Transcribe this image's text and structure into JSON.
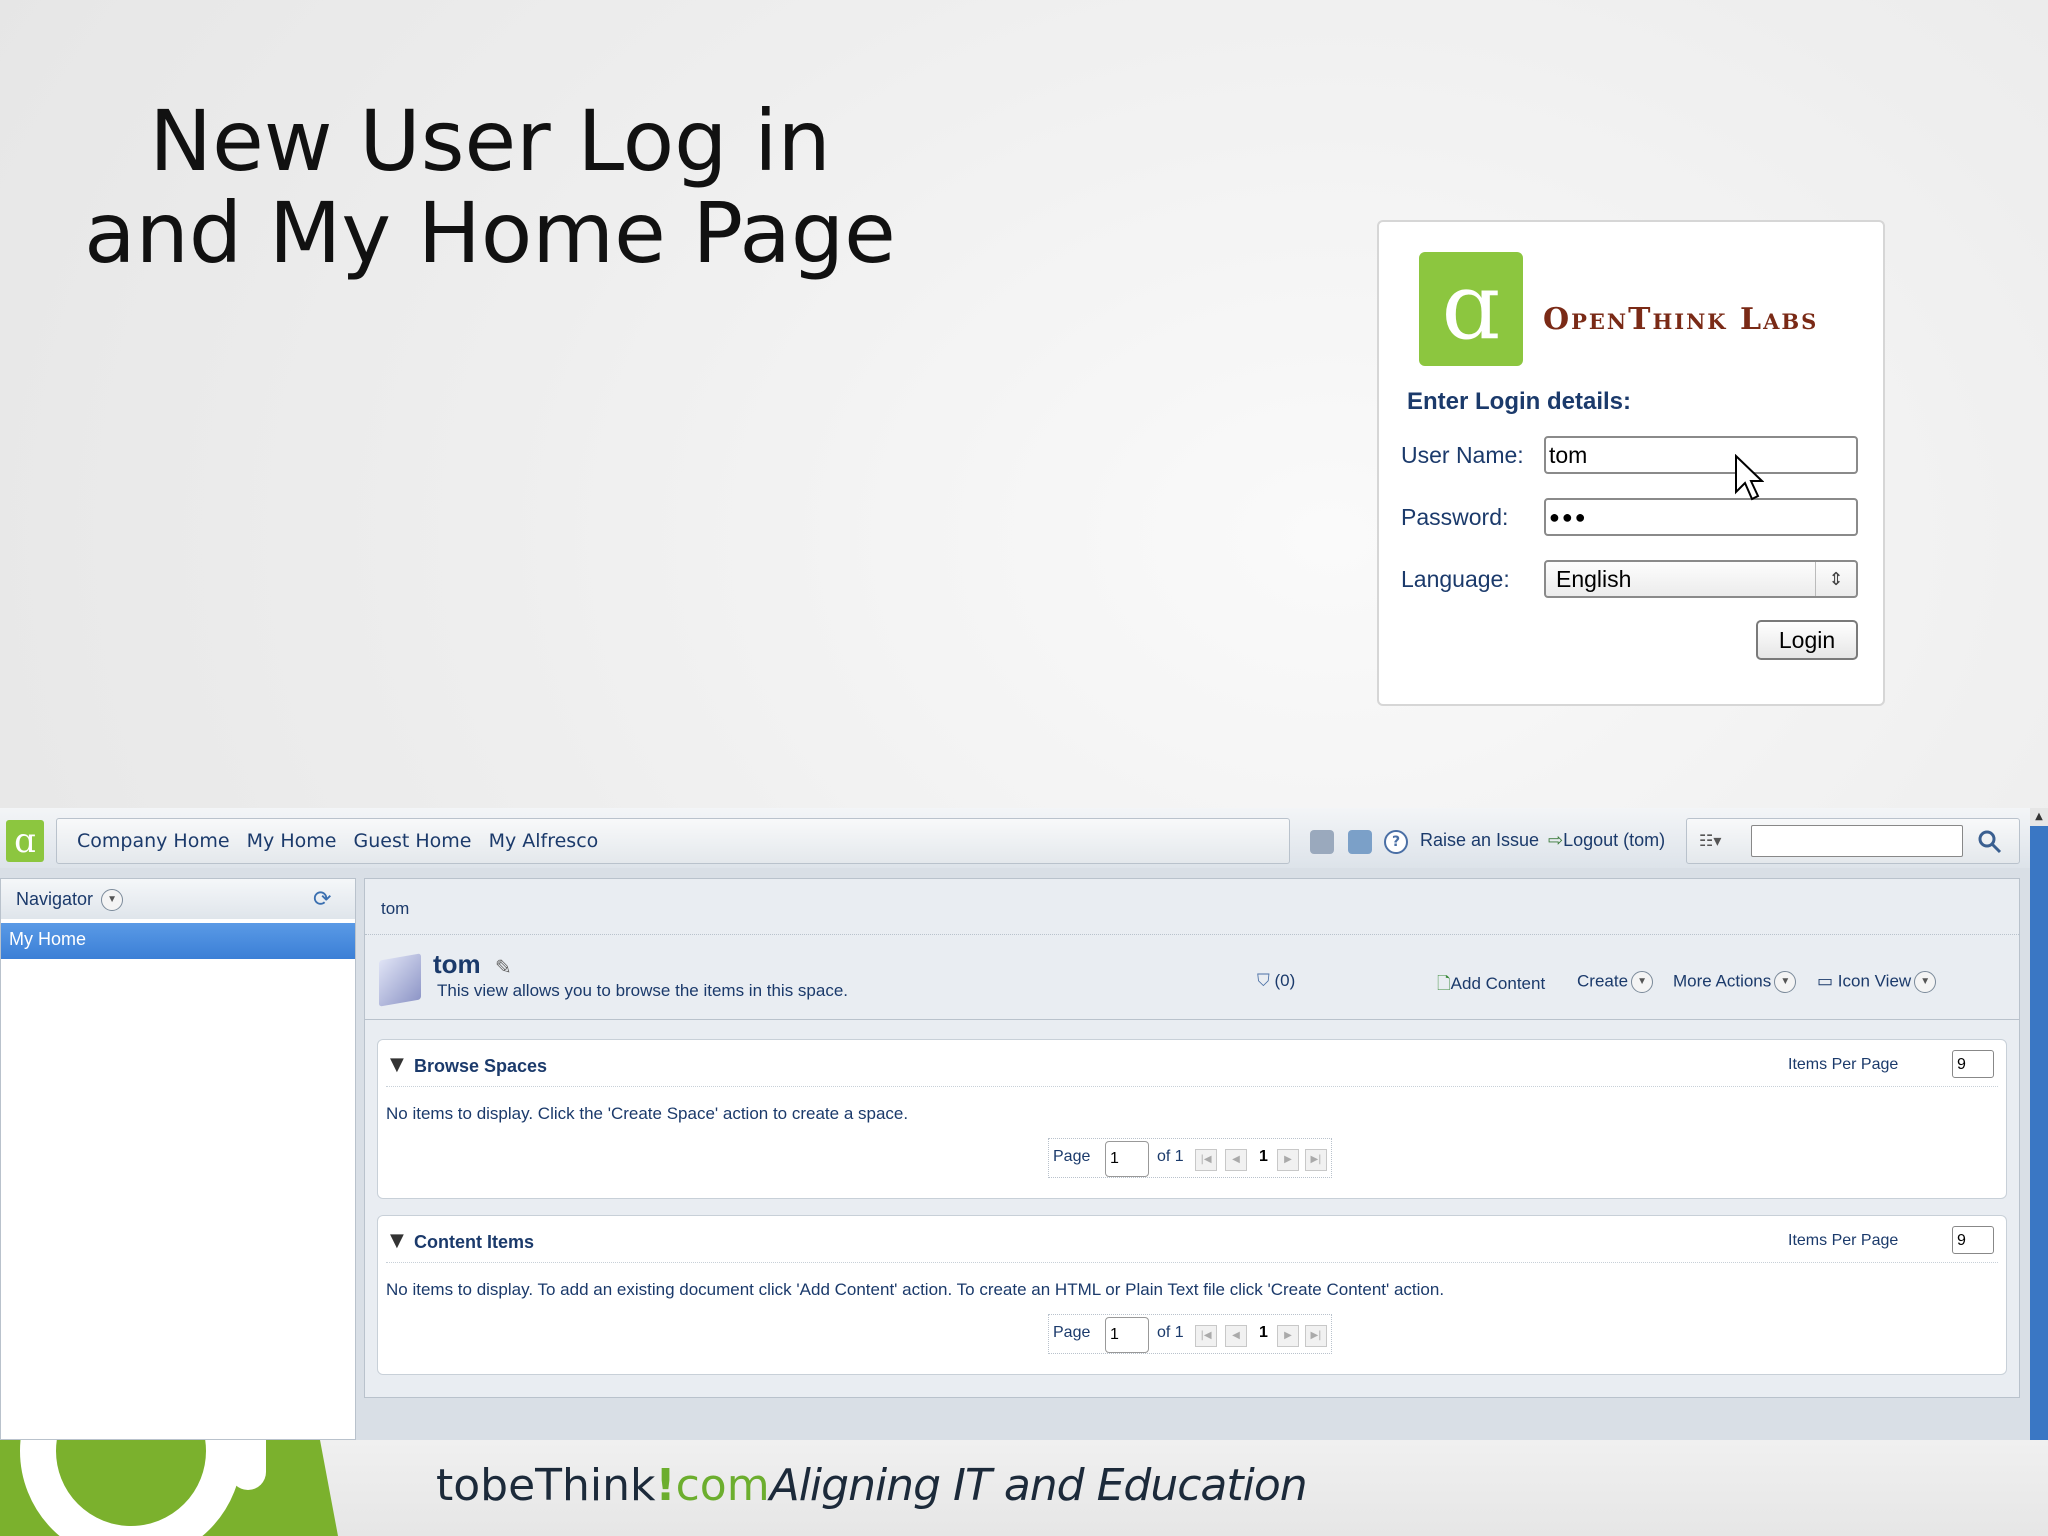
{
  "slide": {
    "title_line1": "New User Log in",
    "title_line2": "and My Home Page"
  },
  "login": {
    "brand": "OpenThink Labs",
    "heading": "Enter Login details:",
    "username_label": "User Name:",
    "username_value": "tom",
    "password_label": "Password:",
    "password_value": "●●●",
    "language_label": "Language:",
    "language_value": "English",
    "login_button": "Login"
  },
  "app": {
    "nav": [
      "Company Home",
      "My Home",
      "Guest Home",
      "My Alfresco"
    ],
    "raise_issue": "Raise an Issue",
    "logout": "Logout (tom)",
    "navigator_title": "Navigator",
    "navigator_selected": "My Home",
    "breadcrumb": "tom",
    "space_name": "tom",
    "space_description": "This view allows you to browse the items in this space.",
    "count": "(0)",
    "actions": {
      "add_content": "Add Content",
      "create": "Create",
      "more_actions": "More Actions",
      "icon_view": "Icon View"
    },
    "panels": [
      {
        "title": "Browse Spaces",
        "items_per_page_label": "Items Per Page",
        "items_per_page": "9",
        "message": "No items to display. Click the 'Create Space' action to create a space.",
        "page_label": "Page",
        "page_value": "1",
        "of_label": "of 1",
        "current_page": "1"
      },
      {
        "title": "Content Items",
        "items_per_page_label": "Items Per Page",
        "items_per_page": "9",
        "message": "No items to display. To add an existing document click 'Add Content' action. To create an HTML or Plain Text file click 'Create Content' action.",
        "page_label": "Page",
        "page_value": "1",
        "of_label": "of 1",
        "current_page": "1"
      }
    ]
  },
  "footer": {
    "brand_to": "tobeThink",
    "brand_bang": "!",
    "brand_com": "com",
    "tagline": "Aligning IT and Education"
  },
  "colors": {
    "brand_green": "#8cc63f",
    "link_blue": "#1b3a6b",
    "selection_blue": "#3b7fd6"
  }
}
